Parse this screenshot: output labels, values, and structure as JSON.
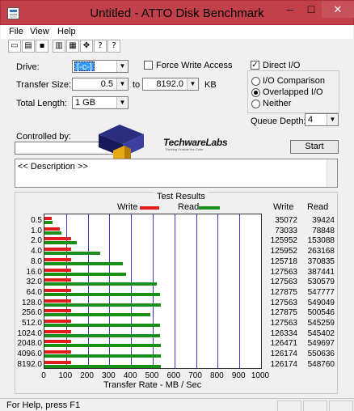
{
  "window": {
    "title": "Untitled - ATTO Disk Benchmark",
    "close_glyph": "✕",
    "minimize_glyph": "–",
    "maximize_glyph": "□"
  },
  "menu": [
    "File",
    "View",
    "Help"
  ],
  "toolbar_icons": [
    "new-icon",
    "open-icon",
    "save-icon",
    "print-icon",
    "print-preview-icon",
    "move-icon",
    "help-icon",
    "context-help-icon"
  ],
  "toolbar_glyphs": [
    "▭",
    "▤",
    "▪",
    "▥",
    "▦",
    "✥",
    "?",
    "?"
  ],
  "form": {
    "drive_label": "Drive:",
    "drive_value": "[-c-]",
    "force_write_label": "Force Write Access",
    "force_write_checked": false,
    "direct_io_label": "Direct I/O",
    "direct_io_checked": true,
    "transfer_size_label": "Transfer Size:",
    "transfer_size_from": "0.5",
    "to_label": "to",
    "transfer_size_to": "8192.0",
    "kb_label": "KB",
    "total_length_label": "Total Length:",
    "total_length_value": "1 GB",
    "io_options": [
      {
        "label": "I/O Comparison",
        "selected": false
      },
      {
        "label": "Overlapped I/O",
        "selected": true
      },
      {
        "label": "Neither",
        "selected": false
      }
    ],
    "queue_depth_label": "Queue Depth:",
    "queue_depth_value": "4",
    "controlled_by_label": "Controlled by:",
    "controlled_by_value": "",
    "start_label": "Start",
    "description_text": "<< Description >>"
  },
  "logo": {
    "brand": "TechwareLabs",
    "tagline": "Thinking Outside the Cube"
  },
  "results": {
    "title": "Test Results",
    "write_legend": "Write",
    "read_legend": "Read",
    "write_header": "Write",
    "read_header": "Read",
    "xlabel": "Transfer Rate - MB / Sec"
  },
  "chart_data": {
    "type": "bar",
    "orientation": "horizontal",
    "title": "Test Results",
    "xlabel": "Transfer Rate - MB / Sec",
    "xlim": [
      0,
      1000
    ],
    "xticks": [
      0,
      100,
      200,
      300,
      400,
      500,
      600,
      700,
      800,
      900,
      1000
    ],
    "categories": [
      "0.5",
      "1.0",
      "2.0",
      "4.0",
      "8.0",
      "16.0",
      "32.0",
      "64.0",
      "128.0",
      "256.0",
      "512.0",
      "1024.0",
      "2048.0",
      "4096.0",
      "8192.0"
    ],
    "series": [
      {
        "name": "Write",
        "color": "#e01c1c",
        "values": [
          35072,
          73033,
          125952,
          125952,
          125718,
          127563,
          127563,
          127875,
          127563,
          127875,
          127563,
          126334,
          126471,
          126174,
          126174
        ]
      },
      {
        "name": "Read",
        "color": "#189018",
        "values": [
          39424,
          78848,
          153088,
          263168,
          370835,
          387441,
          530579,
          547777,
          549049,
          500546,
          545259,
          545402,
          549697,
          550636,
          548760
        ]
      }
    ],
    "grid": true,
    "legend": "top"
  },
  "status": {
    "text": "For Help, press F1"
  }
}
